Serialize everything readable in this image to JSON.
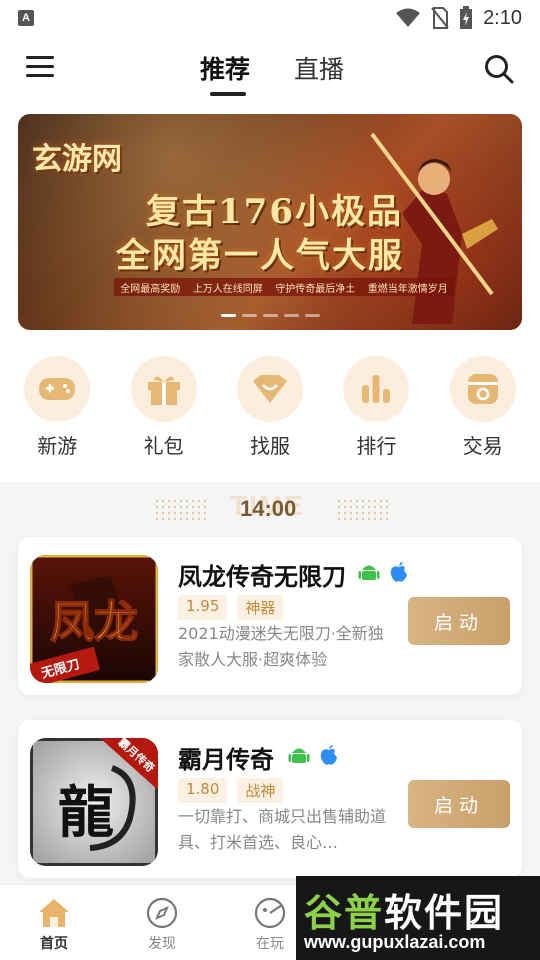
{
  "status_bar": {
    "badge": "A",
    "time": "2:10"
  },
  "header": {
    "tabs": [
      {
        "label": "推荐",
        "active": true
      },
      {
        "label": "直播",
        "active": false
      }
    ]
  },
  "banner": {
    "logo": "玄游网",
    "title_line1": "复古176小极品",
    "title_line2": "全网第一人气大服",
    "subtitle_items": [
      "全网最高奖励",
      "上万人在线同屏",
      "守护传奇最后净土",
      "重燃当年激情岁月"
    ],
    "slide_count": 5,
    "active_slide": 1
  },
  "quick_nav": [
    {
      "label": "新游",
      "icon": "gamepad-icon"
    },
    {
      "label": "礼包",
      "icon": "gift-icon"
    },
    {
      "label": "找服",
      "icon": "heart-icon"
    },
    {
      "label": "排行",
      "icon": "rank-bars-icon"
    },
    {
      "label": "交易",
      "icon": "trade-icon"
    }
  ],
  "time_section": {
    "ghost": "TIME",
    "time": "14:00"
  },
  "games": [
    {
      "name": "凤龙传奇无限刀",
      "icon_text": "凤龙",
      "icon_badge": "无限刀",
      "tags": [
        "1.95",
        "神器"
      ],
      "description": "2021动漫迷失无限刀·全新独家散人大服·超爽体验",
      "button": "启动"
    },
    {
      "name": "霸月传奇",
      "icon_text": "龍",
      "icon_badge": "霸月传奇",
      "tags": [
        "1.80",
        "战神"
      ],
      "description": "一切靠打、商城只出售辅助道具、打米首选、良心…",
      "button": "启动"
    }
  ],
  "bottom_nav": [
    {
      "label": "首页",
      "icon": "home-icon",
      "active": true
    },
    {
      "label": "发现",
      "icon": "compass-icon",
      "active": false
    },
    {
      "label": "在玩",
      "icon": "playing-icon",
      "active": false
    }
  ],
  "watermark": {
    "title_prefix": "谷普",
    "title_suffix": "软件园",
    "url": "www.gupuxlazai.com"
  },
  "colors": {
    "accent": "#c9a06a",
    "tag_text": "#c28a3c",
    "tag_bg": "#fbf1e2",
    "icon_circle": "#fbeedd"
  }
}
